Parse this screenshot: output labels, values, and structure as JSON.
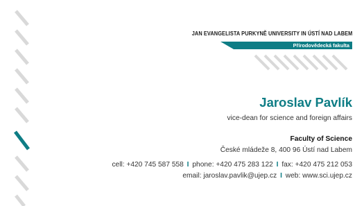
{
  "university": "JAN EVANGELISTA PURKYNĚ UNIVERSITY IN ÚSTÍ NAD LABEM",
  "faculty_badge": "Přírodovědecká fakulta",
  "person": {
    "name": "Jaroslav Pavlík",
    "role": "vice-dean for science and foreign affairs"
  },
  "faculty": {
    "title": "Faculty of Science",
    "address": "České mládeže 8, 400 96 Ústí nad Labem"
  },
  "contact": {
    "cell": "cell: +420 745 587 558",
    "phone": "phone: +420 475 283 122",
    "fax": "fax: +420 475 212 053",
    "email": "email: jaroslav.pavlik@ujep.cz",
    "web": "web: www.sci.ujep.cz",
    "separator": "I"
  },
  "colors": {
    "accent": "#0e7d85",
    "stripe": "#d9d9d9",
    "text": "#333333"
  }
}
